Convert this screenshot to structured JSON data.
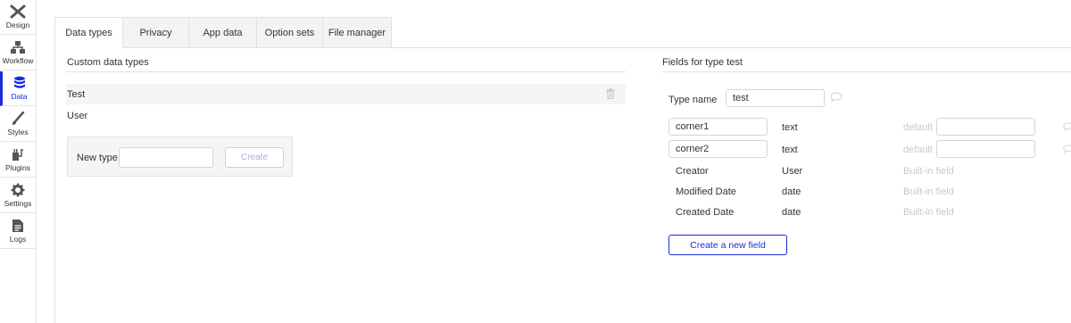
{
  "sidebar": {
    "items": [
      {
        "label": "Design",
        "icon": "design-icon"
      },
      {
        "label": "Workflow",
        "icon": "workflow-icon"
      },
      {
        "label": "Data",
        "icon": "database-icon"
      },
      {
        "label": "Styles",
        "icon": "brush-icon"
      },
      {
        "label": "Plugins",
        "icon": "plugin-icon"
      },
      {
        "label": "Settings",
        "icon": "gear-icon"
      },
      {
        "label": "Logs",
        "icon": "document-icon"
      }
    ],
    "active_index": 2,
    "accent_color": "#1d2ad8"
  },
  "tabs": [
    {
      "label": "Data types"
    },
    {
      "label": "Privacy"
    },
    {
      "label": "App data"
    },
    {
      "label": "Option sets"
    },
    {
      "label": "File manager"
    }
  ],
  "active_tab": 0,
  "left_panel": {
    "title": "Custom data types",
    "types": [
      {
        "name": "Test",
        "selected": true
      },
      {
        "name": "User",
        "selected": false
      }
    ],
    "new_type": {
      "label": "New type",
      "value": "",
      "placeholder": "",
      "button_label": "Create"
    }
  },
  "right_panel": {
    "title": "Fields for type test",
    "type_name_label": "Type name",
    "type_name_value": "test",
    "editable_fields": [
      {
        "name": "corner1",
        "type": "text",
        "default_label": "default",
        "default_value": ""
      },
      {
        "name": "corner2",
        "type": "text",
        "default_label": "default",
        "default_value": ""
      }
    ],
    "builtin_fields": [
      {
        "name": "Creator",
        "type": "User",
        "note": "Built-in field"
      },
      {
        "name": "Modified Date",
        "type": "date",
        "note": "Built-in field"
      },
      {
        "name": "Created Date",
        "type": "date",
        "note": "Built-in field"
      }
    ],
    "create_field_button": "Create a new field"
  }
}
